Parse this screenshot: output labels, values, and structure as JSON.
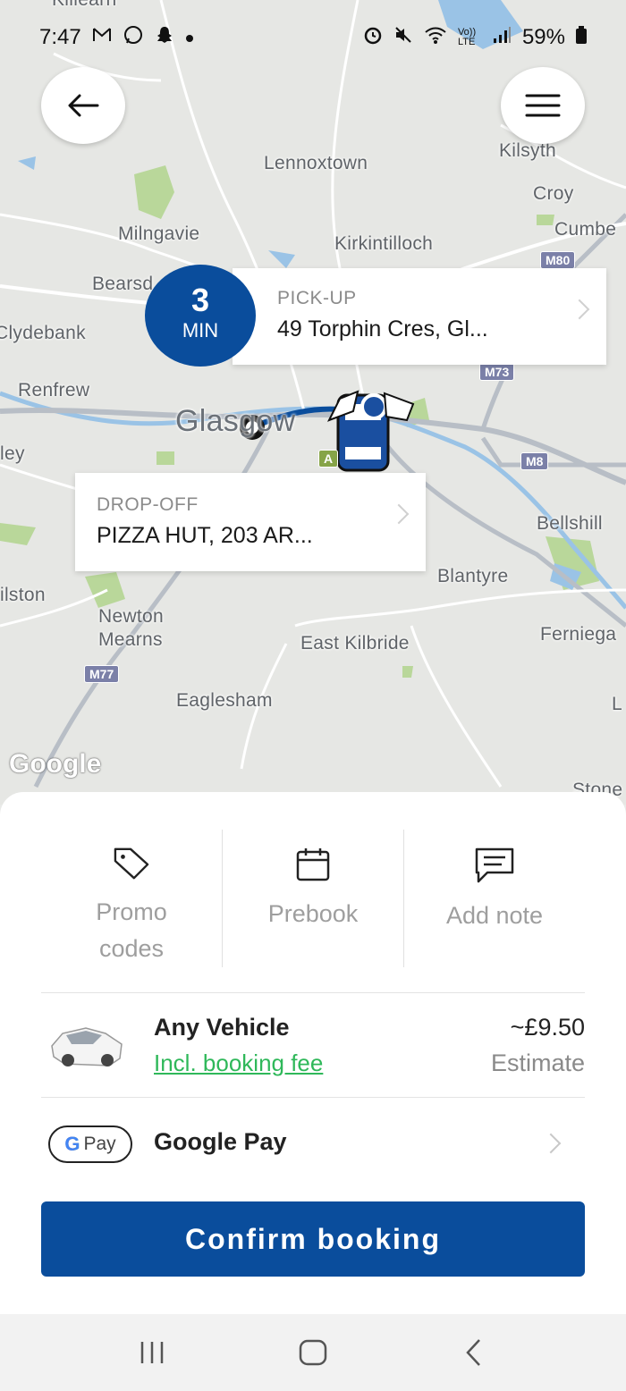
{
  "status_bar": {
    "time": "7:47",
    "left_icons": [
      "gmail-icon",
      "whatsapp-icon",
      "snapchat-icon",
      "dot-icon"
    ],
    "right_icons": [
      "alarm-icon",
      "mute-icon",
      "wifi-icon",
      "volte-icon",
      "signal-icon"
    ],
    "network_label": "Vo)) LTE",
    "battery": "59%"
  },
  "map": {
    "places": {
      "lennoxtown": "Lennoxtown",
      "kilsyth": "Kilsyth",
      "croy": "Croy",
      "cumbernauld": "Cumbe",
      "milngavie": "Milngavie",
      "kirkintilloch": "Kirkintilloch",
      "bearsden": "Bearsd",
      "clydebank": "Clydebank",
      "renfrew": "Renfrew",
      "glasgow": "Glasgow",
      "paisley": "ley",
      "bellshill": "Bellshill",
      "blantyre": "Blantyre",
      "giffnock": "ilston",
      "newton_mearns_1": "Newton",
      "newton_mearns_2": "Mearns",
      "east_kilbride": "East Kilbride",
      "ferniegair": "Ferniega",
      "eaglesham": "Eaglesham",
      "stonehouse": "Stone",
      "l_edge": "L",
      "killearn": "Killearn"
    },
    "shields": {
      "m80": "M80",
      "m73": "M73",
      "m8": "M8",
      "m77": "M77",
      "a": "A"
    },
    "attribution": "Google"
  },
  "pickup": {
    "eta_value": "3",
    "eta_unit": "MIN",
    "label": "PICK-UP",
    "address": "49 Torphin Cres, Gl..."
  },
  "dropoff": {
    "label": "DROP-OFF",
    "address": "PIZZA HUT, 203 AR..."
  },
  "options": {
    "promo": {
      "label_line1": "Promo",
      "label_line2": "codes",
      "icon": "tag-icon"
    },
    "prebook": {
      "label": "Prebook",
      "icon": "calendar-icon"
    },
    "note": {
      "label": "Add note",
      "icon": "message-icon"
    }
  },
  "vehicle": {
    "name": "Any Vehicle",
    "fee_text": "Incl. booking fee",
    "price": "~£9.50",
    "price_note": "Estimate"
  },
  "payment": {
    "badge_g": "G",
    "badge_pay": "Pay",
    "method": "Google Pay"
  },
  "confirm_label": "Confirm booking",
  "colors": {
    "primary": "#0a4d9c",
    "link_green": "#2fb85a",
    "muted": "#9e9e9e"
  },
  "nav": [
    "recents-icon",
    "home-icon",
    "back-icon"
  ]
}
